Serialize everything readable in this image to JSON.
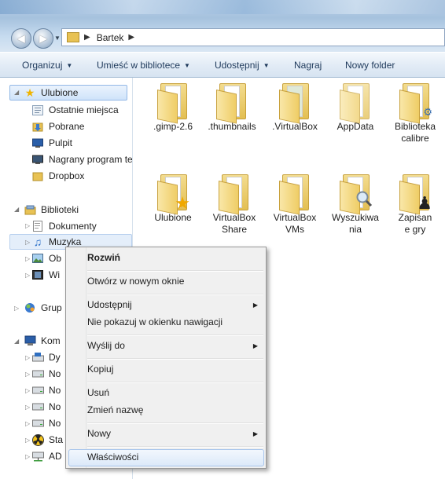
{
  "window": {
    "address": {
      "crumb": "Bartek"
    }
  },
  "toolbar": {
    "organize": "Organizuj",
    "add_to_library": "Umieść w bibliotece",
    "share": "Udostępnij",
    "burn": "Nagraj",
    "new_folder": "Nowy folder"
  },
  "nav": {
    "favorites": {
      "header": "Ulubione",
      "items": [
        "Ostatnie miejsca",
        "Pobrane",
        "Pulpit",
        "Nagrany program te",
        "Dropbox"
      ]
    },
    "libraries": {
      "header": "Biblioteki",
      "items": [
        "Dokumenty",
        "Muzyka",
        "Ob",
        "Wi"
      ]
    },
    "homegroup": "Grup",
    "computer": {
      "header": "Kom",
      "items": [
        "Dy",
        "No",
        "No",
        "No",
        "No",
        "Sta",
        "AD"
      ]
    }
  },
  "content": {
    "items": [
      {
        "name": ".gimp-2.6",
        "icon": "folder-icon"
      },
      {
        "name": ".thumbnails",
        "icon": "folder-icon"
      },
      {
        "name": ".VirtualBox",
        "icon": "folder-icon"
      },
      {
        "name": "AppData",
        "icon": "folder-icon"
      },
      {
        "name": "Biblioteka calibre",
        "icon": "folder-calibre-icon"
      },
      {
        "name": "Ulubione",
        "icon": "folder-star-icon"
      },
      {
        "name": "VirtualBox Share",
        "icon": "folder-icon"
      },
      {
        "name": "VirtualBox VMs",
        "icon": "folder-icon"
      },
      {
        "name": "Wyszukiwania",
        "icon": "folder-search-icon"
      },
      {
        "name": "Zapisane gry",
        "icon": "folder-chess-icon"
      }
    ]
  },
  "context_menu": {
    "expand": "Rozwiń",
    "open_new_window": "Otwórz w nowym oknie",
    "share": "Udostępnij",
    "hide_nav": "Nie pokazuj w okienku nawigacji",
    "send_to": "Wyślij do",
    "copy": "Kopiuj",
    "delete": "Usuń",
    "rename": "Zmień nazwę",
    "new": "Nowy",
    "properties": "Właściwości"
  },
  "colors": {
    "selection": "#cfe3fa",
    "toolbar_text": "#1e395b",
    "folder": "#e8c254"
  }
}
